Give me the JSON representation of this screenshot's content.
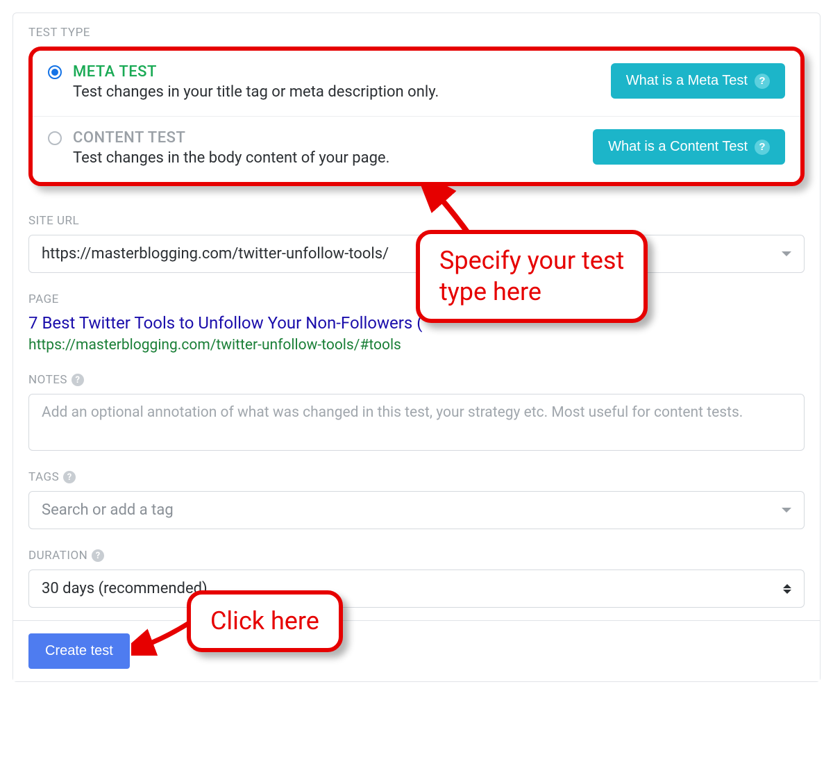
{
  "labels": {
    "test_type": "TEST TYPE",
    "site_url": "SITE URL",
    "page": "PAGE",
    "notes": "NOTES",
    "tags": "TAGS",
    "duration": "DURATION"
  },
  "options": {
    "meta": {
      "title": "META TEST",
      "desc": "Test changes in your title tag or meta description only.",
      "info_btn": "What is a Meta Test"
    },
    "content": {
      "title": "CONTENT TEST",
      "desc": "Test changes in the body content of your page.",
      "info_btn": "What is a Content Test"
    }
  },
  "site_url": {
    "value": "https://masterblogging.com/twitter-unfollow-tools/"
  },
  "page": {
    "title": "7 Best Twitter Tools to Unfollow Your Non-Followers (",
    "url": "https://masterblogging.com/twitter-unfollow-tools/#tools"
  },
  "notes": {
    "placeholder": "Add an optional annotation of what was changed in this test, your strategy etc. Most useful for content tests."
  },
  "tags": {
    "placeholder": "Search or add a tag"
  },
  "duration": {
    "value": "30 days (recommended)"
  },
  "buttons": {
    "create": "Create test"
  },
  "annotations": {
    "specify": "Specify your test\ntype here",
    "click": "Click here"
  }
}
